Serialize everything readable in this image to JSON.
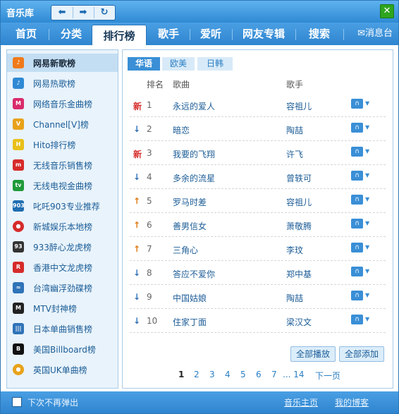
{
  "window": {
    "title": "音乐库"
  },
  "nav": {
    "back_icon": "left-arrow-icon",
    "forward_icon": "right-arrow-icon",
    "refresh_icon": "refresh-icon",
    "close_icon": "close-icon",
    "back_glyph": "⬅",
    "forward_glyph": "➡",
    "refresh_glyph": "↻",
    "close_glyph": "✕"
  },
  "tabs": [
    {
      "label": "首页"
    },
    {
      "label": "分类"
    },
    {
      "label": "排行榜"
    },
    {
      "label": "歌手"
    },
    {
      "label": "爱听"
    },
    {
      "label": "网友专辑"
    },
    {
      "label": "搜索"
    }
  ],
  "message_center": {
    "icon": "envelope-icon",
    "glyph": "✉",
    "label": "消息台"
  },
  "sidebar": {
    "items": [
      {
        "label": "网易新歌榜",
        "icon_text": "♪",
        "color": "#f07a1a"
      },
      {
        "label": "网易热歌榜",
        "icon_text": "♪",
        "color": "#2f8ad4"
      },
      {
        "label": "网络音乐金曲榜",
        "icon_text": "M",
        "color": "#d92b6b"
      },
      {
        "label": "Channel[V]榜",
        "icon_text": "V",
        "color": "#e8a21a"
      },
      {
        "label": "Hito排行榜",
        "icon_text": "H",
        "color": "#e8c01a"
      },
      {
        "label": "无线音乐销售榜",
        "icon_text": "m",
        "color": "#d62b2b"
      },
      {
        "label": "无线电视金曲榜",
        "icon_text": "tv",
        "color": "#1f9a3a"
      },
      {
        "label": "叱吒903专业推荐",
        "icon_text": "903",
        "color": "#1f6db1"
      },
      {
        "label": "新城娱乐本地榜",
        "icon_text": "●",
        "color": "#d62b2b"
      },
      {
        "label": "933醉心龙虎榜",
        "icon_text": "93",
        "color": "#333333"
      },
      {
        "label": "香港中文龙虎榜",
        "icon_text": "R",
        "color": "#d62b2b"
      },
      {
        "label": "台湾幽浮劲碟榜",
        "icon_text": "≈",
        "color": "#2f73b8"
      },
      {
        "label": "MTV封神榜",
        "icon_text": "M",
        "color": "#222222"
      },
      {
        "label": "日本单曲销售榜",
        "icon_text": "|||",
        "color": "#2f73b8"
      },
      {
        "label": "美国Billboard榜",
        "icon_text": "B",
        "color": "#111111"
      },
      {
        "label": "英国UK单曲榜",
        "icon_text": "●",
        "color": "#e8a21a"
      }
    ]
  },
  "subtabs": [
    {
      "label": "华语"
    },
    {
      "label": "欧美"
    },
    {
      "label": "日韩"
    }
  ],
  "table": {
    "headers": {
      "rank": "排名",
      "song": "歌曲",
      "artist": "歌手"
    },
    "rows": [
      {
        "trend": "new",
        "trend_text": "新",
        "rank": "1",
        "song": "永远的爱人",
        "artist": "容祖儿"
      },
      {
        "trend": "down",
        "trend_text": "↓",
        "rank": "2",
        "song": "暗恋",
        "artist": "陶喆"
      },
      {
        "trend": "new",
        "trend_text": "新",
        "rank": "3",
        "song": "我要的飞翔",
        "artist": "许飞"
      },
      {
        "trend": "down",
        "trend_text": "↓",
        "rank": "4",
        "song": "多余的流星",
        "artist": "曾轶可"
      },
      {
        "trend": "up",
        "trend_text": "↑",
        "rank": "5",
        "song": "罗马时差",
        "artist": "容祖儿"
      },
      {
        "trend": "up",
        "trend_text": "↑",
        "rank": "6",
        "song": "善男信女",
        "artist": "萧敬腾"
      },
      {
        "trend": "up",
        "trend_text": "↑",
        "rank": "7",
        "song": "三角心",
        "artist": "李玟"
      },
      {
        "trend": "down",
        "trend_text": "↓",
        "rank": "8",
        "song": "答应不爱你",
        "artist": "郑中基"
      },
      {
        "trend": "down",
        "trend_text": "↓",
        "rank": "9",
        "song": "中国姑娘",
        "artist": "陶喆"
      },
      {
        "trend": "down",
        "trend_text": "↓",
        "rank": "10",
        "song": "住家丁面",
        "artist": "梁汉文"
      }
    ],
    "listen_icon": "headphones-icon",
    "listen_glyph": "∩",
    "dropdown_glyph": "▼"
  },
  "actions": {
    "play_all": "全部播放",
    "add_all": "全部添加"
  },
  "pager": {
    "pages": [
      "1",
      "2",
      "3",
      "4",
      "5",
      "6",
      "7"
    ],
    "ellipsis": "... 14",
    "next": "下一页",
    "current": "1"
  },
  "footer": {
    "no_popup": "下次不再弹出",
    "music_home": "音乐主页",
    "my_blog": "我的博客"
  }
}
